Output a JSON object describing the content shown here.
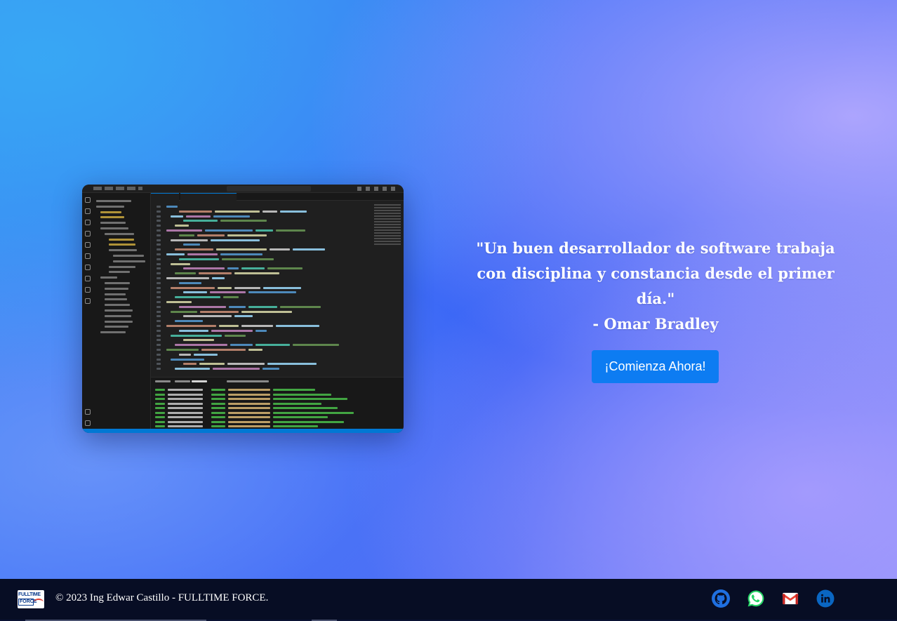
{
  "hero": {
    "screenshot_alt": "Captura del editor de código",
    "quote_lines": [
      "\"Un buen desarrollador de software trabaja",
      "con disciplina y constancia desde el primer",
      "día.\"",
      "- Omar Bradley"
    ],
    "cta_label": "¡Comienza Ahora!",
    "cta_color": "#0d7cf2"
  },
  "footer": {
    "logo_text_top": "FULLTIME",
    "logo_text_bottom": "FORCE",
    "copyright": "© 2023 Ing Edwar Castillo - FULLTIME FORCE.",
    "social": [
      {
        "icon": "github-icon",
        "color": "#1f6fe0"
      },
      {
        "icon": "whatsapp-icon",
        "color": "#25d366"
      },
      {
        "icon": "gmail-icon",
        "color": "#ea4335"
      },
      {
        "icon": "linkedin-icon",
        "color": "#0a66c2"
      }
    ]
  }
}
